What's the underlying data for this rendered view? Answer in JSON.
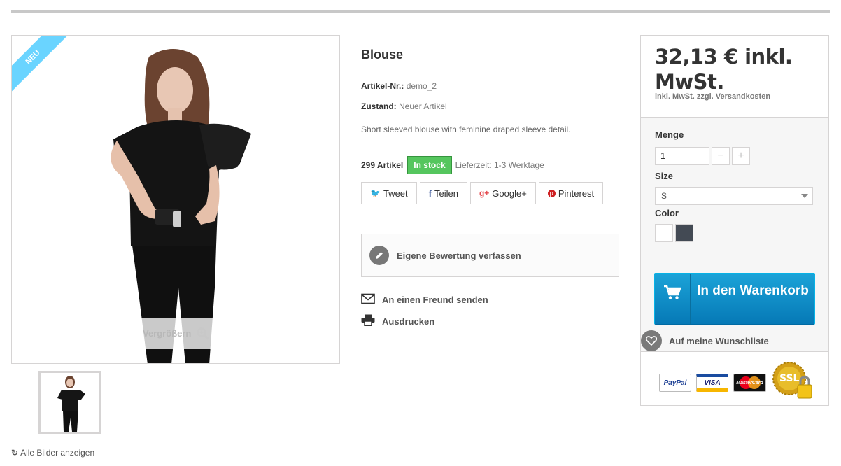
{
  "image": {
    "ribbon": "Neu",
    "zoom_label": "Vergrößern",
    "all_images_label": "Alle Bilder anzeigen"
  },
  "product": {
    "title": "Blouse",
    "ref_label": "Artikel-Nr.:",
    "ref_value": "demo_2",
    "condition_label": "Zustand:",
    "condition_value": "Neuer Artikel",
    "description": "Short sleeved blouse with feminine draped sleeve detail.",
    "quantity_text": "299 Artikel",
    "stock_badge": "In stock",
    "delivery": "Lieferzeit: 1-3 Werktage"
  },
  "share": {
    "tweet": "Tweet",
    "facebook": "Teilen",
    "google": "Google+",
    "pinterest": "Pinterest"
  },
  "review": {
    "label": "Eigene Bewertung verfassen"
  },
  "links": {
    "send_friend": "An einen Freund senden",
    "print": "Ausdrucken"
  },
  "buy_box": {
    "price": "32,13 € inkl. MwSt.",
    "tax_note": "inkl. MwSt. zzgl. Versandkosten",
    "quantity_label": "Menge",
    "quantity_value": "1",
    "minus": "−",
    "plus": "+",
    "size_label": "Size",
    "size_value": "S",
    "color_label": "Color",
    "colors": [
      "#ffffff",
      "#434a54"
    ],
    "cart_label": "In den Warenkorb",
    "wishlist_label": "Auf meine Wunschliste",
    "payment_logos": [
      "PayPal",
      "VISA",
      "MasterCard",
      "SSL"
    ]
  },
  "colors": {
    "accent": "#0679b6",
    "ribbon": "#6ad4ff",
    "in_stock": "#55c65e"
  }
}
